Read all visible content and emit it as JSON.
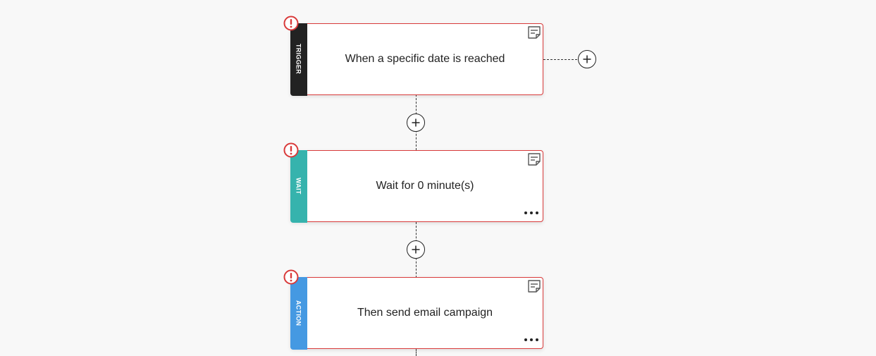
{
  "colors": {
    "error": "#d93a3a",
    "trigger_stripe": "#222222",
    "wait_stripe": "#36b3ad",
    "action_stripe": "#4599e2",
    "connector": "#333333"
  },
  "icons": {
    "error": "error-exclamation-icon",
    "note": "note-icon",
    "more": "more-horizontal-icon",
    "add": "plus-icon"
  },
  "nodes": [
    {
      "type_label": "TRIGGER",
      "title": "When a specific date is reached",
      "has_error": true,
      "has_more_menu": false
    },
    {
      "type_label": "WAIT",
      "title": "Wait for 0 minute(s)",
      "has_error": true,
      "has_more_menu": true
    },
    {
      "type_label": "ACTION",
      "title": "Then send email campaign",
      "has_error": true,
      "has_more_menu": true
    }
  ]
}
